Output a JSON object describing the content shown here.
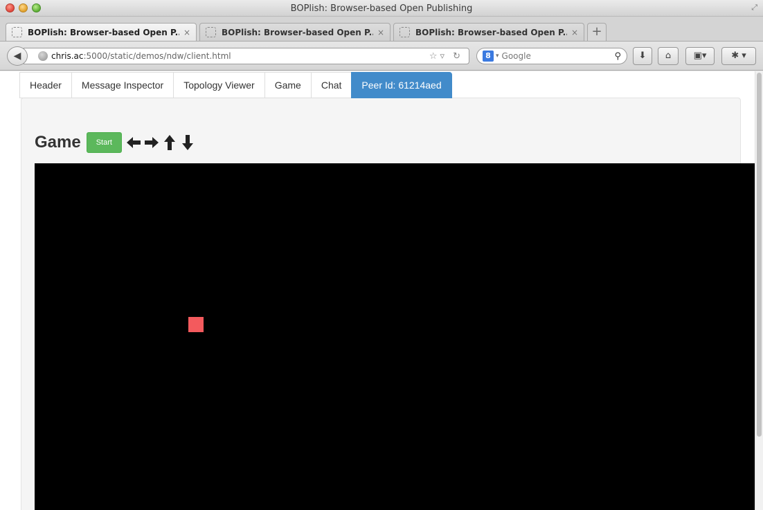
{
  "window": {
    "title": "BOPlish: Browser-based Open Publishing"
  },
  "browser_tabs": [
    {
      "label": "BOPlish: Browser-based Open P...",
      "close": "×",
      "active": true
    },
    {
      "label": "BOPlish: Browser-based Open P...",
      "close": "×",
      "active": false
    },
    {
      "label": "BOPlish: Browser-based Open P...",
      "close": "×",
      "active": false
    }
  ],
  "new_tab_label": "+",
  "address": {
    "host": "chris.ac",
    "path": ":5000/static/demos/ndw/client.html"
  },
  "search": {
    "engine_badge": "8",
    "placeholder": "Google"
  },
  "nav_tabs": [
    {
      "label": "Header"
    },
    {
      "label": "Message Inspector"
    },
    {
      "label": "Topology Viewer"
    },
    {
      "label": "Game"
    },
    {
      "label": "Chat"
    },
    {
      "label": "Peer Id: 61214aed",
      "active": true
    }
  ],
  "game": {
    "title": "Game",
    "start_label": "Start",
    "controls": [
      "arrow-left-icon",
      "arrow-right-icon",
      "arrow-up-icon",
      "arrow-down-icon"
    ],
    "canvas_color": "#000000",
    "player_color": "#f35a5d"
  },
  "colors": {
    "active_tab": "#428bca",
    "start_button": "#5cb85c"
  }
}
